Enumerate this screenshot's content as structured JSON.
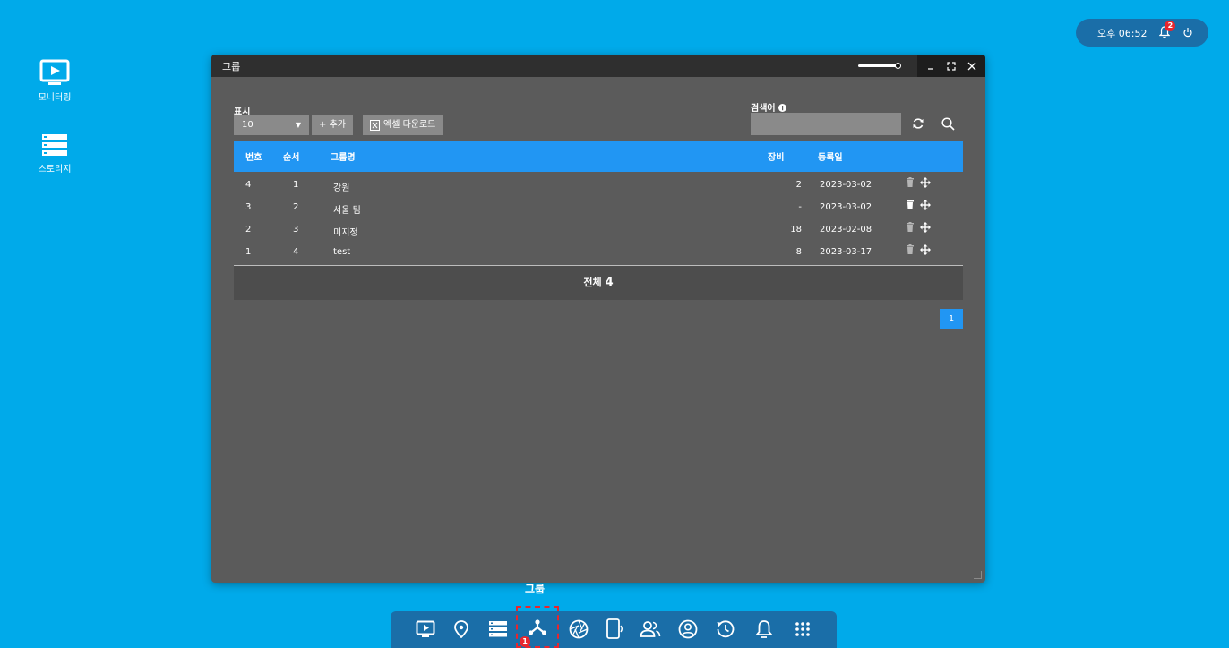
{
  "status": {
    "time": "오후 06:52",
    "notification_count": "2"
  },
  "desktop": [
    {
      "label": "모니터링",
      "icon": "monitor-play-icon"
    },
    {
      "label": "스토리지",
      "icon": "storage-icon"
    }
  ],
  "window": {
    "title": "그룹",
    "display_label": "표시",
    "display_value": "10",
    "add_label": "+ 추가",
    "excel_label": "엑셀 다운로드",
    "search_label": "검색어",
    "search_value": "",
    "columns": {
      "no": "번호",
      "order": "순서",
      "name": "그룹명",
      "devices": "장비",
      "date": "등록일"
    },
    "rows": [
      {
        "no": "4",
        "order": "1",
        "name": "강원",
        "devices": "2",
        "date": "2023-03-02"
      },
      {
        "no": "3",
        "order": "2",
        "name": "서울 팀",
        "devices": "-",
        "date": "2023-03-02"
      },
      {
        "no": "2",
        "order": "3",
        "name": "미지정",
        "devices": "18",
        "date": "2023-02-08"
      },
      {
        "no": "1",
        "order": "4",
        "name": "test",
        "devices": "8",
        "date": "2023-03-17"
      }
    ],
    "total_label": "전체",
    "total_count": "4",
    "page": "1"
  },
  "taskbar": {
    "tooltip": "그룹",
    "active_badge": "1",
    "items": [
      "monitor-play-icon",
      "location-pin-icon",
      "storage-icon",
      "group-icon",
      "camera-aperture-icon",
      "device-icon",
      "users-icon",
      "user-circle-icon",
      "history-icon",
      "bell-icon",
      "apps-grid-icon"
    ]
  },
  "colors": {
    "desktop_bg": "#00aaea",
    "accent": "#2196f3",
    "window_bg": "#5b5b5b",
    "alert": "#e8262e"
  }
}
